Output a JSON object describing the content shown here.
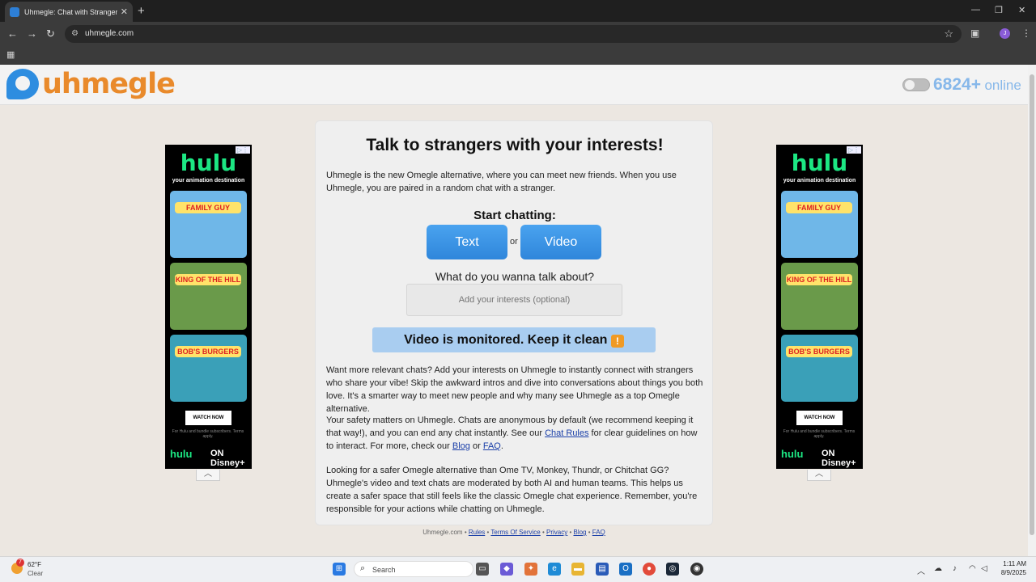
{
  "browser": {
    "tab_title": "Uhmegle: Chat with Strangers |",
    "tab_close": "✕",
    "new_tab": "+",
    "url": "uhmegle.com",
    "profile_initial": "J"
  },
  "header": {
    "logo_text": "uhmegle",
    "online_count": "6824+",
    "online_label": "online"
  },
  "ad": {
    "brand": "hulu",
    "tagline": "your animation destination",
    "shows": [
      "FAMILY GUY",
      "KING OF THE HILL",
      "BOB'S BURGERS"
    ],
    "cta": "WATCH NOW",
    "fine_print": "For Hulu and bundle subscribers. Terms apply.",
    "bottom_brand": "hulu",
    "partner": "ON Disney+"
  },
  "card": {
    "title": "Talk to strangers with your interests!",
    "intro": "Uhmegle is the new Omegle alternative, where you can meet new friends. When you use Uhmegle, you are paired in a random chat with a stranger.",
    "start_label": "Start chatting:",
    "text_button": "Text",
    "or": "or",
    "video_button": "Video",
    "question": "What do you wanna talk about?",
    "interest_placeholder": "Add your interests (optional)",
    "monitor_text": "Video is monitored. Keep it clean",
    "monitor_icon": "!",
    "para1": "Want more relevant chats? Add your interests on Uhmegle to instantly connect with strangers who share your vibe! Skip the awkward intros and dive into conversations about things you both love. It's a smarter way to meet new people and why many see Uhmegle as a top Omegle alternative.",
    "para2_a": "Your safety matters on Uhmegle. Chats are anonymous by default (we recommend keeping it that way!), and you can end any chat instantly. See our ",
    "para2_rules": "Chat Rules",
    "para2_b": " for clear guidelines on how to interact. For more, check our ",
    "para2_blog": "Blog",
    "para2_or": " or ",
    "para2_faq": "FAQ",
    "para2_end": ".",
    "para3": "Looking for a safer Omegle alternative than Ome TV, Monkey, Thundr, or Chitchat GG? Uhmegle's video and text chats are moderated by both AI and human teams. This helps us create a safer space that still feels like the classic Omegle chat experience. Remember, you're responsible for your actions while chatting on Uhmegle."
  },
  "footer": {
    "site": "Uhmegle.com",
    "sep": " • ",
    "links": [
      "Rules",
      "Terms Of Service",
      "Privacy",
      "Blog",
      "FAQ"
    ]
  },
  "taskbar": {
    "temp": "62°F",
    "condition": "Clear",
    "weather_badge": "7",
    "search_placeholder": "Search",
    "time": "1:11 AM",
    "date": "8/9/2025"
  }
}
